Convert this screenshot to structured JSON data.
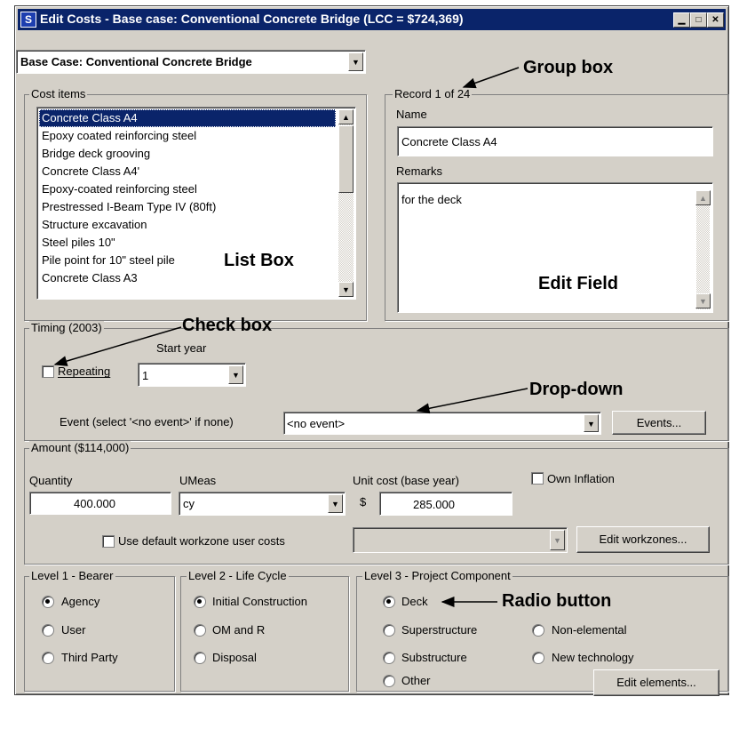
{
  "window": {
    "title": "Edit Costs - Base case: Conventional Concrete Bridge (LCC = $724,369)",
    "app_icon": "S"
  },
  "case_select": {
    "value": "Base Case: Conventional Concrete Bridge"
  },
  "cost_items": {
    "label": "Cost items",
    "items": [
      "Concrete Class A4",
      "Epoxy coated reinforcing steel",
      "Bridge deck grooving",
      "Concrete Class A4'",
      "Epoxy-coated reinforcing steel",
      "Prestressed I-Beam Type IV (80ft)",
      "Structure excavation",
      "Steel piles 10\"",
      "Pile point for 10\" steel pile",
      "Concrete Class A3"
    ],
    "selected_index": 0
  },
  "record": {
    "label": "Record 1 of  24",
    "name_label": "Name",
    "name_value": "Concrete Class A4",
    "remarks_label": "Remarks",
    "remarks_value": "for the deck"
  },
  "timing": {
    "label": "Timing (2003)",
    "start_year_label": "Start year",
    "repeating_label": "Repeating",
    "repeating_checked": false,
    "start_year_value": "1",
    "event_label": "Event (select '<no event>' if none)",
    "event_value": "<no event>",
    "events_button": "Events..."
  },
  "amount": {
    "label": "Amount ($114,000)",
    "quantity_label": "Quantity",
    "quantity_value": "400.000",
    "umeas_label": "UMeas",
    "umeas_value": "cy",
    "unit_cost_label": "Unit cost (base year)",
    "dollar": "$",
    "unit_cost_value": "285.000",
    "own_inflation_label": "Own Inflation",
    "own_inflation_checked": false,
    "workzone_label": "Use default workzone user costs",
    "workzone_checked": false,
    "workzone_value": "",
    "edit_workzones_button": "Edit workzones..."
  },
  "level1": {
    "label": "Level 1 - Bearer",
    "options": [
      "Agency",
      "User",
      "Third Party"
    ],
    "selected": "Agency"
  },
  "level2": {
    "label": "Level 2 - Life Cycle",
    "options": [
      "Initial Construction",
      "OM and R",
      "Disposal"
    ],
    "selected": "Initial Construction"
  },
  "level3": {
    "label": "Level 3 - Project Component",
    "options": [
      "Deck",
      "Superstructure",
      "Non-elemental",
      "Substructure",
      "New technology",
      "Other"
    ],
    "selected": "Deck",
    "edit_elements_button": "Edit elements..."
  },
  "annotations": {
    "group_box": "Group box",
    "list_box": "List Box",
    "edit_field": "Edit Field",
    "check_box": "Check box",
    "drop_down": "Drop-down",
    "radio_button": "Radio button"
  }
}
